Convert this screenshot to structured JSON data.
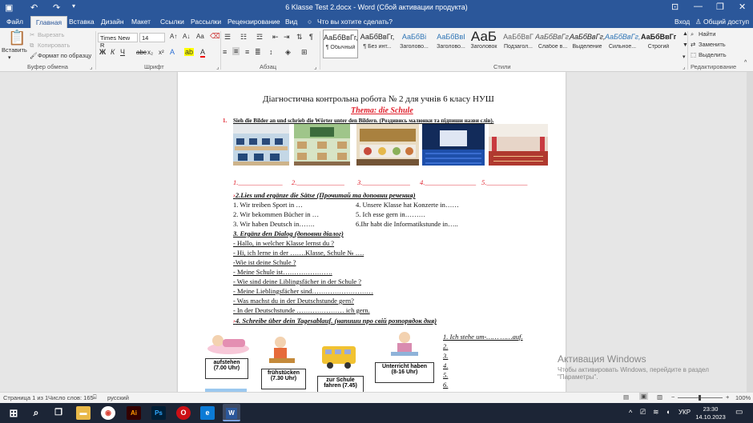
{
  "titlebar": {
    "title": "6 Klasse Test 2.docx - Word (Сбой активации продукта)"
  },
  "tabs": {
    "file": "Файл",
    "home": "Главная",
    "insert": "Вставка",
    "design": "Дизайн",
    "layout": "Макет",
    "references": "Ссылки",
    "mailings": "Рассылки",
    "review": "Рецензирование",
    "view": "Вид",
    "tell_me": "Что вы хотите сделать?",
    "signin": "Вход",
    "share": "Общий доступ"
  },
  "ribbon": {
    "clipboard": {
      "paste": "Вставить",
      "cut": "Вырезать",
      "copy": "Копировать",
      "format_painter": "Формат по образцу",
      "group": "Буфер обмена"
    },
    "font": {
      "name": "Times New R",
      "size": "14",
      "group": "Шрифт"
    },
    "paragraph": {
      "group": "Абзац"
    },
    "styles": {
      "group": "Стили",
      "items": [
        {
          "sample": "АаБбВвГг,",
          "name": "¶ Обычный"
        },
        {
          "sample": "АаБбВвГг,",
          "name": "¶ Без инт..."
        },
        {
          "sample": "АаБбВі",
          "name": "Заголово..."
        },
        {
          "sample": "АаБбВвІ",
          "name": "Заголово..."
        },
        {
          "sample": "АаБ",
          "name": "Заголовок"
        },
        {
          "sample": "АаБбВвГ",
          "name": "Подзагол..."
        },
        {
          "sample": "АаБбВвГг,",
          "name": "Слабое в..."
        },
        {
          "sample": "АаБбВвГг,",
          "name": "Выделение"
        },
        {
          "sample": "АаБбВвГг,",
          "name": "Сильное..."
        },
        {
          "sample": "АаБбВвГг,",
          "name": "Строгий"
        }
      ]
    },
    "editing": {
      "find": "Найти",
      "replace": "Заменить",
      "select": "Выделить",
      "group": "Редактирование"
    }
  },
  "doc": {
    "title": "Діагностична контрольна робота  № 2  для учнів 6 класу НУШ",
    "theme": "Thema: die Schule",
    "task1_num": "1.",
    "task1": "Sieh die Bilder an und schrieb die Wörter unter den Bildern. (Роздивись малюнки та підпиши назви слів).",
    "blanks": [
      "1._____________",
      "2.______________",
      "3.______________",
      "4._______________",
      "5.____________"
    ],
    "task2": "2.Lies und ergänze die Sätse    (Прочитай та доповни речення)",
    "sent_left": [
      "1. Wir treiben Sport in …",
      "2. Wir bekommen Bücher in …",
      "3. Wir haben Deutsch in……."
    ],
    "sent_right": [
      "4. Unsere Klasse hat  Konzerte in……",
      "5. Ich esse gern in………",
      "6.Ihr habt die Informatikstunde in….."
    ],
    "task3": "3. Ergänz den Dialog (доповни діалог)",
    "dialog": [
      "- Hallo, in welcher Klasse lernst du ?",
      "- Hi, ich lerne in der …….Klasse, Schule № ….",
      "-Wie ist deine Schule ?",
      "- Meine Schule ist………………….",
      "- Wie sind deine Liblingsfächer in der Schule ?",
      "- Meine Lieblingsfächer sind………………………",
      "- Was machst du in der Deutschstunde gern?",
      "- In der Deutschstunde ………………… ich gern."
    ],
    "task4": "4.  Schreibe über dein Tagesablauf. (напиши про свій розпорядок дня)",
    "cards": [
      {
        "label": "aufstehen",
        "time": "(7.00 Uhr)"
      },
      {
        "label": "frühstücken",
        "time": "(7.30 Uhr)"
      },
      {
        "label": "zur Schule",
        "time": "fahren (7.45)"
      },
      {
        "label": "Unterricht haben",
        "time": "(8-16 Uhr)"
      }
    ],
    "answers": [
      "1. Ich stehe um-……  ……auf.",
      "2.",
      "3.",
      "4.",
      "5.",
      "6."
    ]
  },
  "watermark": {
    "line1": "Активация Windows",
    "line2": "Чтобы активировать Windows, перейдите в раздел",
    "line3": "\"Параметры\"."
  },
  "status": {
    "page": "Страница 1 из 1",
    "words": "Число слов: 165",
    "lang": "русский",
    "zoom": "100%"
  },
  "taskbar": {
    "lang": "УКР",
    "time": "23:30",
    "date": "14.10.2023"
  }
}
